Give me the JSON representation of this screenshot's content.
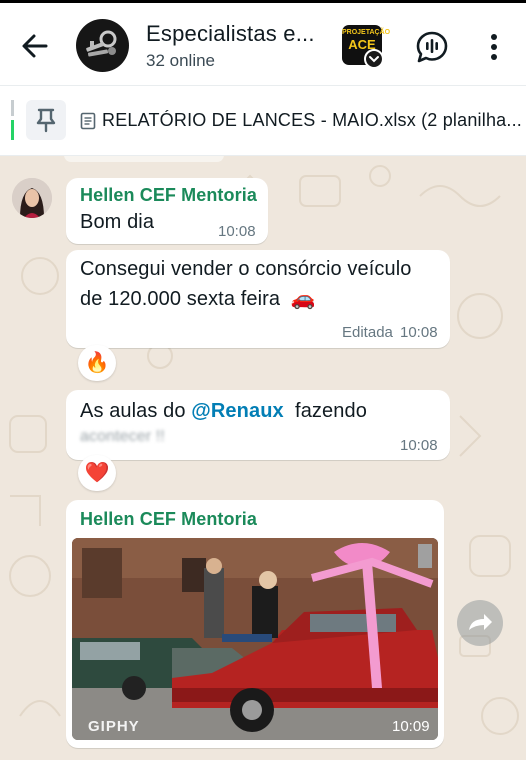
{
  "header": {
    "title": "Especialistas e...",
    "subtitle": "32 online",
    "badge_top": "PROJETAÇÃO",
    "badge_main": "ACE"
  },
  "pinned": {
    "text": "RELATÓRIO DE LANCES - MAIO.xlsx (2 planilha..."
  },
  "messages": [
    {
      "sender": "Hellen CEF Mentoria",
      "text": "Bom dia",
      "time": "10:08"
    },
    {
      "text": "Consegui vender o consórcio veículo de 120.000 sexta feira 🚗",
      "line1": "Consegui vender o consórcio veículo",
      "line2": "de 120.000 sexta feira",
      "emoji": "🚗",
      "edited_label": "Editada",
      "time": "10:08",
      "reaction": "🔥"
    },
    {
      "prefix": "As aulas do ",
      "mention": "@Renaux",
      "suffix": "  fazendo",
      "line2_blurred": "acontecer !!",
      "time": "10:08",
      "reaction": "❤️"
    },
    {
      "sender": "Hellen CEF Mentoria",
      "gif_label": "GIPHY",
      "time": "10:09"
    }
  ],
  "colors": {
    "sender": "#1b8a5a",
    "mention": "#027eb5",
    "wallpaper": "#efe7dd",
    "accent": "#25d366"
  },
  "icons": [
    "back-arrow-icon",
    "group-avatar-keys",
    "app-badge-icon",
    "voice-chat-icon",
    "more-vert-icon",
    "pin-icon",
    "document-icon",
    "forward-icon"
  ]
}
